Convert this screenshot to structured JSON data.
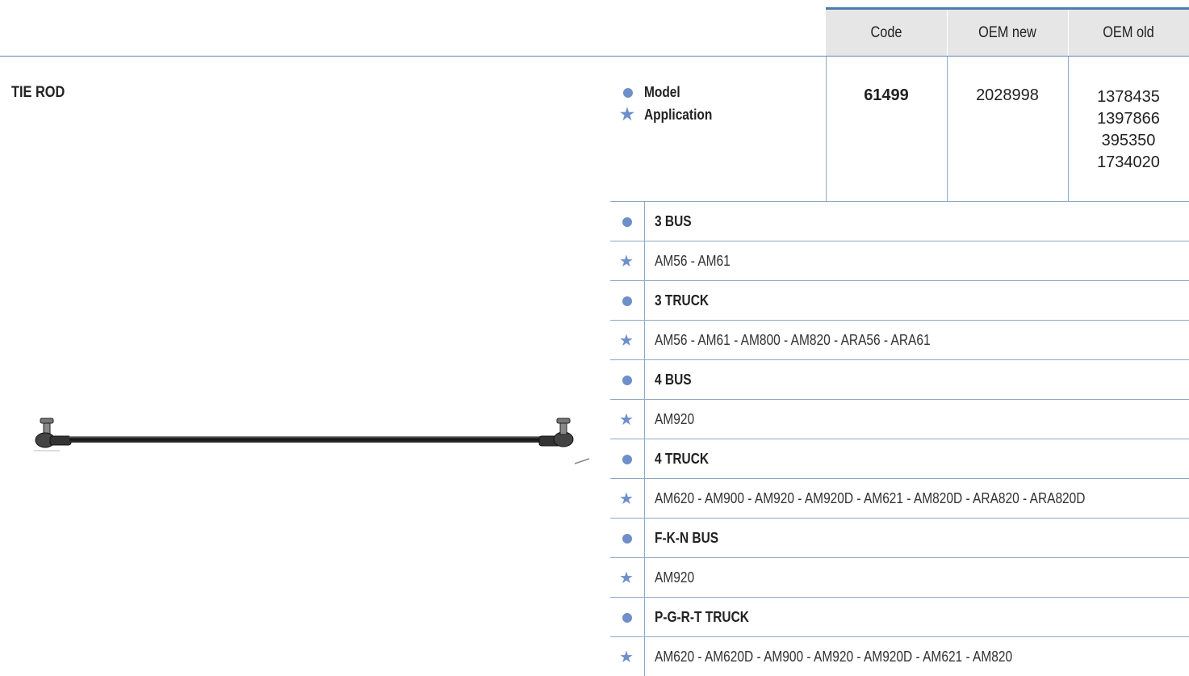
{
  "header": {
    "columns": [
      "Code",
      "OEM new",
      "OEM old"
    ]
  },
  "product": {
    "title": "TIE ROD",
    "code": "61499",
    "oem_new": "2028998",
    "oem_old": [
      "1378435",
      "1397866",
      "395350",
      "1734020"
    ],
    "image_icon": "tie-rod-photo"
  },
  "legend": {
    "model_label": "Model",
    "application_label": "Application",
    "model_icon": "dot-icon",
    "application_icon": "star-icon"
  },
  "applications": [
    {
      "model": "3 BUS",
      "application": "AM56 - AM61"
    },
    {
      "model": "3 TRUCK",
      "application": "AM56 - AM61 - AM800 - AM820 - ARA56 - ARA61"
    },
    {
      "model": "4 BUS",
      "application": "AM920"
    },
    {
      "model": "4 TRUCK",
      "application": "AM620 - AM900 - AM920 - AM920D - AM621 - AM820D - ARA820 - ARA820D"
    },
    {
      "model": "F-K-N BUS",
      "application": "AM920"
    },
    {
      "model": "P-G-R-T TRUCK",
      "application": "AM620 - AM620D - AM900 - AM920 - AM920D - AM621 - AM820"
    }
  ],
  "colors": {
    "accent": "#4a7cb2",
    "icon": "#6f8fca",
    "header_bg": "#e6e6e6",
    "rule": "#8fa8c6"
  }
}
